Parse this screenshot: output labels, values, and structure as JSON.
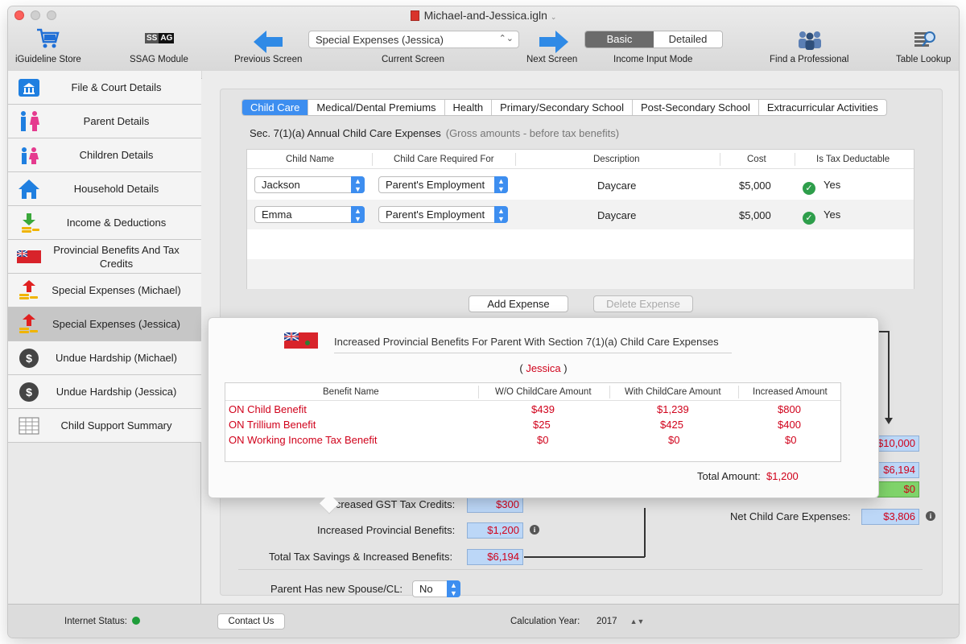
{
  "window": {
    "title": "Michael-and-Jessica.igln"
  },
  "toolbar": {
    "store_label": "iGuideline Store",
    "ssag_label": "SSAG Module",
    "ssag_badge_ss": "SS",
    "ssag_badge_ag": "AG",
    "prev_label": "Previous Screen",
    "current_label": "Current Screen",
    "current_value": "Special Expenses (Jessica)",
    "next_label": "Next Screen",
    "mode_label": "Income Input Mode",
    "mode_basic": "Basic",
    "mode_detailed": "Detailed",
    "find_label": "Find a Professional",
    "table_label": "Table Lookup"
  },
  "sidebar": {
    "items": [
      {
        "label": "File & Court Details",
        "icon": "courthouse-icon"
      },
      {
        "label": "Parent Details",
        "icon": "parents-icon"
      },
      {
        "label": "Children Details",
        "icon": "children-icon"
      },
      {
        "label": "Household Details",
        "icon": "house-icon"
      },
      {
        "label": "Income & Deductions",
        "icon": "income-icon"
      },
      {
        "label": "Provincial Benefits And Tax Credits",
        "icon": "ontario-flag-icon"
      },
      {
        "label": "Special Expenses (Michael)",
        "icon": "expenses-icon"
      },
      {
        "label": "Special Expenses (Jessica)",
        "icon": "expenses-icon"
      },
      {
        "label": "Undue Hardship (Michael)",
        "icon": "hardship-icon"
      },
      {
        "label": "Undue Hardship (Jessica)",
        "icon": "hardship-icon"
      },
      {
        "label": "Child Support Summary",
        "icon": "summary-icon"
      }
    ]
  },
  "tabs": [
    "Child Care",
    "Medical/Dental Premiums",
    "Health",
    "Primary/Secondary School",
    "Post-Secondary School",
    "Extracurricular Activities"
  ],
  "section": {
    "title": "Sec. 7(1)(a)  Annual Child Care Expenses",
    "subtitle": "(Gross amounts - before tax benefits)"
  },
  "expense_table": {
    "headers": [
      "Child Name",
      "Child Care Required For",
      "Description",
      "Cost",
      "Is Tax Deductable"
    ],
    "rows": [
      {
        "child": "Jackson",
        "required_for": "Parent's Employment",
        "description": "Daycare",
        "cost": "$5,000",
        "deductible": "Yes"
      },
      {
        "child": "Emma",
        "required_for": "Parent's Employment",
        "description": "Daycare",
        "cost": "$5,000",
        "deductible": "Yes"
      }
    ]
  },
  "buttons": {
    "add": "Add Expense",
    "delete": "Delete Expense",
    "contact": "Contact Us"
  },
  "summary": {
    "gst_label": "Increased GST Tax Credits:",
    "gst_value": "$300",
    "prov_label": "Increased Provincial Benefits:",
    "prov_value": "$1,200",
    "total_label": "Total Tax Savings & Increased Benefits:",
    "total_value": "$6,194",
    "right_values": [
      "$10,000",
      "$6,194",
      "$0"
    ],
    "net_label": "Net Child Care Expenses:",
    "net_value": "$3,806",
    "spouse_label": "Parent Has new Spouse/CL:",
    "spouse_value": "No"
  },
  "popover": {
    "title": "Increased Provincial Benefits For Parent With Section 7(1)(a) Child Care Expenses",
    "parent_open": "(",
    "parent_name": "Jessica",
    "parent_close": ")",
    "headers": [
      "Benefit Name",
      "W/O ChildCare Amount",
      "With ChildCare Amount",
      "Increased Amount"
    ],
    "rows": [
      {
        "name": "ON Child Benefit",
        "without": "$439",
        "with": "$1,239",
        "increased": "$800"
      },
      {
        "name": "ON Trillium Benefit",
        "without": "$25",
        "with": "$425",
        "increased": "$400"
      },
      {
        "name": "ON Working Income Tax Benefit",
        "without": "$0",
        "with": "$0",
        "increased": "$0"
      }
    ],
    "total_label": "Total Amount:",
    "total_value": "$1,200"
  },
  "status": {
    "internet_label": "Internet Status:",
    "year_label": "Calculation Year:",
    "year_value": "2017"
  },
  "colors": {
    "accent": "#3d8ef0",
    "value_red": "#d0021b",
    "value_bg": "#bcd7f7",
    "ok_green": "#2e9e4b"
  }
}
